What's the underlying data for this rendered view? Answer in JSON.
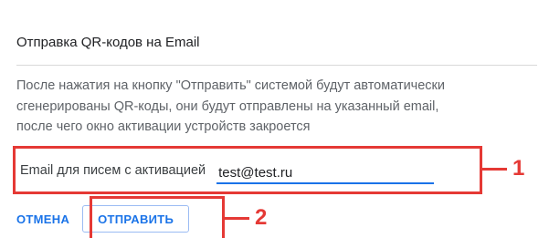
{
  "dialog": {
    "title": "Отправка QR-кодов на Email",
    "description_lines": [
      "После нажатия на кнопку \"Отправить\" системой будут автоматически",
      "сгенерированы QR-коды, они будут отправлены на указанный email,",
      "после чего окно активации устройств закроется"
    ],
    "email_label": "Email для писем с активацией",
    "email_value": "test@test.ru",
    "cancel_label": "ОТМЕНА",
    "send_label": "ОТПРАВИТЬ"
  },
  "annotations": {
    "callout_1": "1",
    "callout_2": "2",
    "color": "#e53935"
  },
  "colors": {
    "accent": "#1a73e8"
  }
}
